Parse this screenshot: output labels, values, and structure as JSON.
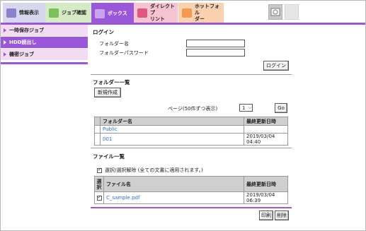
{
  "tabs": [
    {
      "label": "情報表示",
      "icon": "info-icon"
    },
    {
      "label": "ジョブ確認",
      "icon": "job-icon"
    },
    {
      "label": "ボックス",
      "icon": "box-icon"
    },
    {
      "label_line1": "ダイレクトプ",
      "label_line2": "リント",
      "icon": "direct-print-icon"
    },
    {
      "label_line1": "ホットフォル",
      "label_line2": "ダー",
      "icon": "hot-folder-icon"
    }
  ],
  "sidebar": {
    "items": [
      {
        "label": "一時保存ジョブ"
      },
      {
        "label": "HDD読出し"
      },
      {
        "label": "機密ジョブ"
      }
    ]
  },
  "login": {
    "title": "ログイン",
    "folder_name_label": "フォルダー名",
    "folder_password_label": "フォルダーパスワード",
    "folder_name_value": "",
    "folder_password_value": "",
    "login_button": "ログイン"
  },
  "folder_list": {
    "title": "フォルダー一覧",
    "new_button": "新規作成",
    "page_label": "ページ(50件ずつ表示)",
    "page_value": "1",
    "go_button": "Go",
    "columns": [
      "フォルダー名",
      "最終更新日時"
    ],
    "rows": [
      {
        "name": "Public",
        "date": ""
      },
      {
        "name": "001",
        "date": "2019/03/04 04:40"
      }
    ]
  },
  "file_list": {
    "title": "ファイル一覧",
    "select_all_label": "選択/選択解除 (全ての文書に適用されます。)",
    "columns": [
      "選択",
      "ファイル名",
      "最終更新日時"
    ],
    "select_col_line1": "選",
    "select_col_line2": "択",
    "rows": [
      {
        "name": "C_sample.pdf",
        "date": "2019/03/04 06:39",
        "checked": true
      }
    ],
    "print_button": "印刷",
    "delete_button": "削除"
  }
}
